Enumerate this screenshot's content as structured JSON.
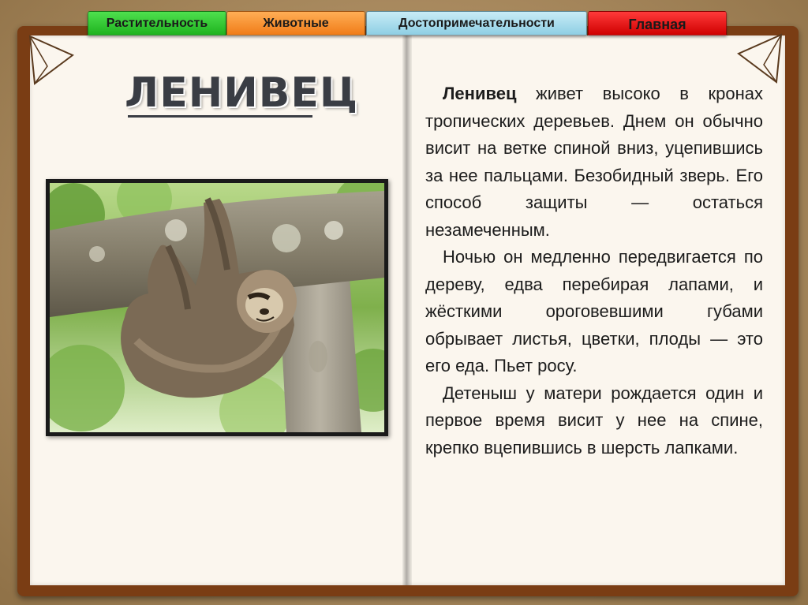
{
  "nav": {
    "tabs": [
      {
        "label": "Растительность",
        "color": "#2cc52c"
      },
      {
        "label": "Животные",
        "color": "#f48b28"
      },
      {
        "label": "Достопримечательности",
        "color": "#a6dcec"
      },
      {
        "label": "Главная",
        "color": "#e21010"
      }
    ]
  },
  "page": {
    "title": "ЛЕНИВЕЦ",
    "photo_caption": "sloth-photo",
    "paragraphs": [
      {
        "lead": "Ленивец",
        "text": " живет высоко в кронах тропических деревьев. Днем он обычно висит на ветке спиной вниз, уцепившись за нее пальцами. Безобидный зверь. Его способ защиты — остаться незамеченным."
      },
      {
        "lead": "",
        "text": "Ночью он медленно передвигается по дереву, едва перебирая лапами, и жёсткими ороговевшими губами обрывает листья, цветки, плоды — это его еда. Пьет росу."
      },
      {
        "lead": "",
        "text": "Детеныш у матери рождается один и первое время висит у нее на спине, крепко вцепившись в шерсть лапками."
      }
    ]
  }
}
